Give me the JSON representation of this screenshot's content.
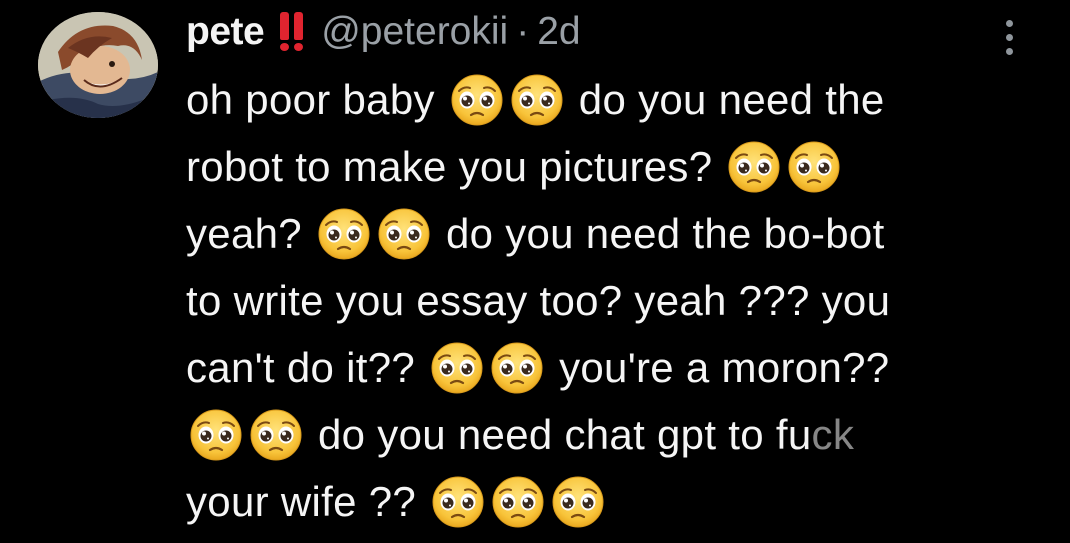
{
  "author": {
    "name": "pete",
    "handle": "@peterokii",
    "separator": "·",
    "time": "2d"
  },
  "icons": {
    "badge": "double-exclamation-icon",
    "emoji": "pleading-face-emoji",
    "more": "more-vertical-icon"
  },
  "colors": {
    "background": "#000000",
    "text": "#f5f5f5",
    "secondary": "#9aa0a6",
    "badge": "#e0242f"
  },
  "tweet": {
    "lines": [
      {
        "a": "oh poor baby",
        "b": "do you need the"
      },
      {
        "a": "robot to make you pictures?"
      },
      {
        "a": "yeah?",
        "b": "do you need the bo-bot"
      },
      {
        "a": "to write you essay too? yeah ??? you"
      },
      {
        "a": "can't do it??",
        "b": "you're a moron??"
      },
      {
        "b": "do you need chat gpt to fu",
        "c": "ck"
      },
      {
        "a": "your wife ??"
      }
    ]
  }
}
